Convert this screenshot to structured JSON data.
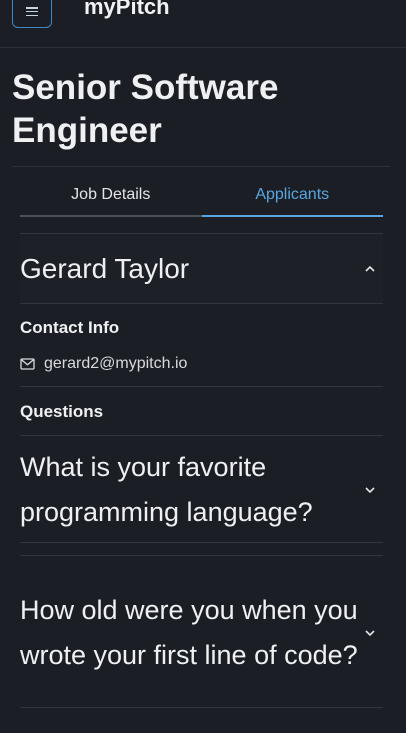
{
  "navbar": {
    "brand": "myPitch",
    "menu_icon": "hamburger-menu-icon"
  },
  "job": {
    "title": "Senior Software Engineer"
  },
  "tabs": [
    {
      "label": "Job Details",
      "active": false
    },
    {
      "label": "Applicants",
      "active": true
    }
  ],
  "applicant": {
    "name": "Gerard Taylor",
    "expanded": true,
    "contact_label": "Contact Info",
    "email": "gerard2@mypitch.io",
    "questions_label": "Questions",
    "questions": [
      {
        "text": "What is your favorite programming language?",
        "expanded": false
      },
      {
        "text": "How old were you when you wrote your first line of code?",
        "expanded": false
      }
    ]
  },
  "colors": {
    "background": "#1b1e24",
    "accent": "#58a6e0",
    "menu_border": "#3f89c9"
  }
}
